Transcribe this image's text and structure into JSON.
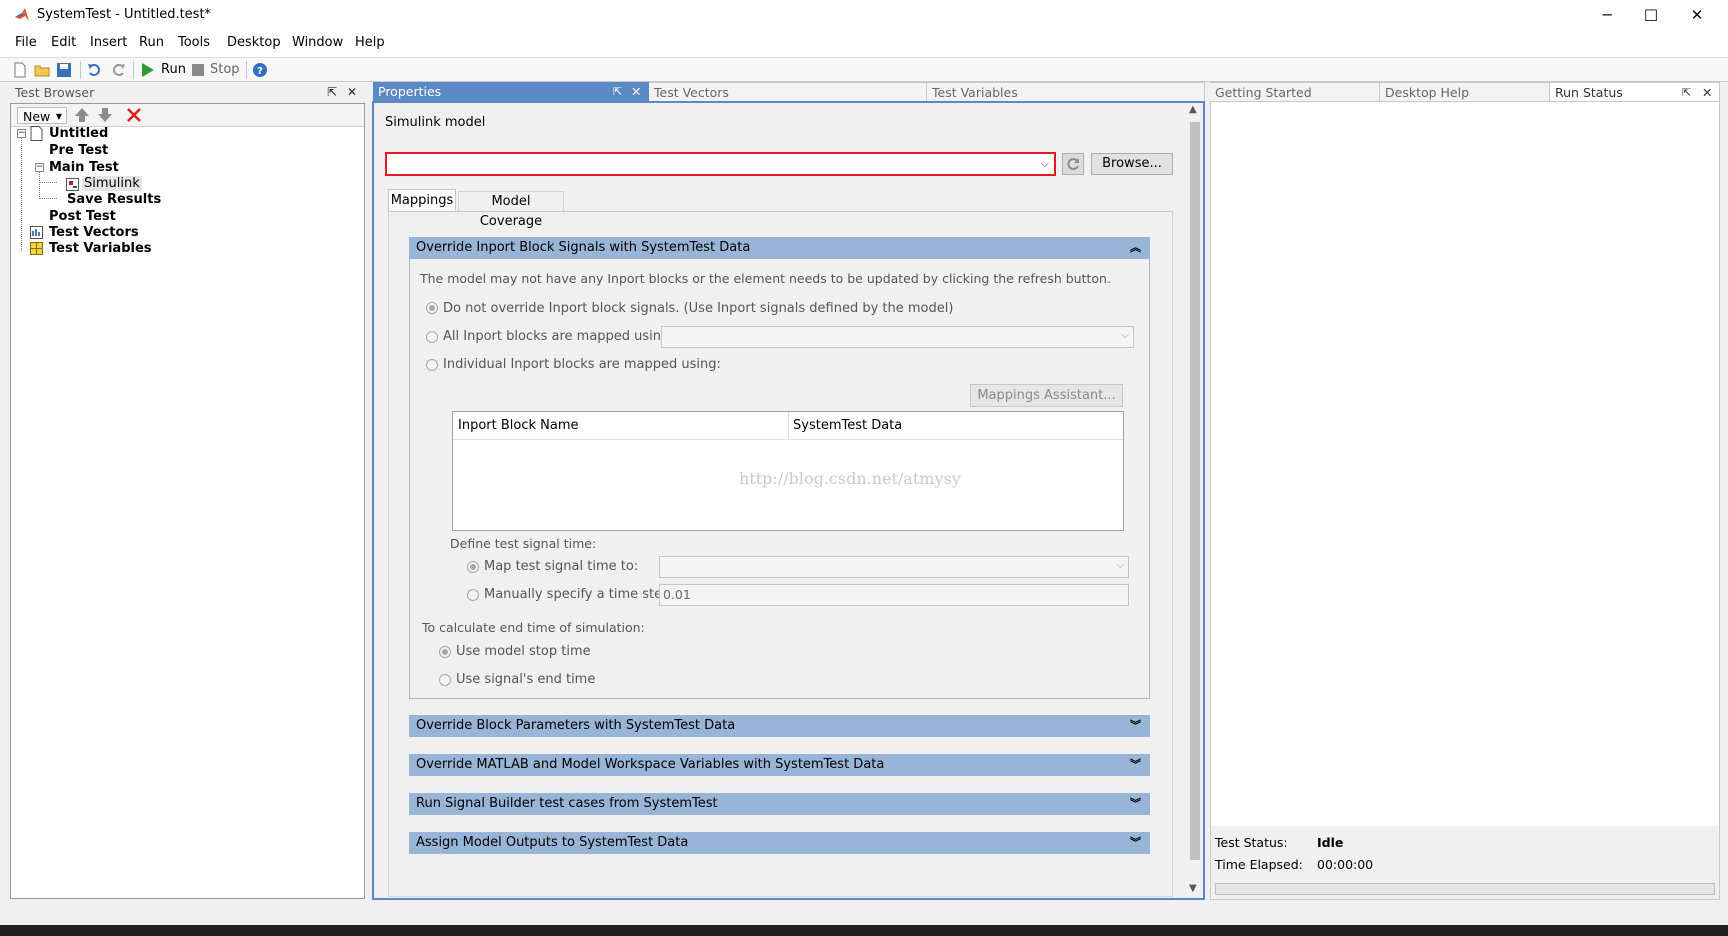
{
  "window": {
    "title": "SystemTest - Untitled.test*",
    "minimize": "─",
    "maximize": "☐",
    "close": "✕"
  },
  "menu": [
    "File",
    "Edit",
    "Insert",
    "Run",
    "Tools",
    "Desktop",
    "Window",
    "Help"
  ],
  "toolbar": {
    "run_label": "Run",
    "stop_label": "Stop"
  },
  "test_browser": {
    "title": "Test Browser",
    "new_label": "New",
    "tree": {
      "root": "Untitled",
      "pre_test": "Pre Test",
      "main_test": "Main Test",
      "simulink": "Simulink",
      "save_results": "Save Results",
      "post_test": "Post Test",
      "test_vectors": "Test Vectors",
      "test_variables": "Test Variables"
    }
  },
  "center_tabs": {
    "properties": "Properties",
    "test_vectors": "Test Vectors",
    "test_variables": "Test Variables"
  },
  "properties": {
    "simulink_model_label": "Simulink model",
    "model_value": "",
    "browse_label": "Browse...",
    "tabs": {
      "mappings": "Mappings",
      "model_coverage": "Model Coverage"
    },
    "override_inport": {
      "header": "Override Inport Block Signals with SystemTest Data",
      "note": "The model may not have any Inport blocks or the element needs to be updated by clicking the refresh button.",
      "opt_no_override": "Do not override Inport block signals. (Use Inport signals defined by the model)",
      "opt_all": "All Inport blocks are mapped using:",
      "opt_individual": "Individual Inport blocks are mapped using:",
      "mappings_assistant": "Mappings Assistant...",
      "table_headers": [
        "Inport Block Name",
        "SystemTest Data"
      ],
      "watermark": "http://blog.csdn.net/atmysy",
      "define_time": "Define test signal time:",
      "opt_map_time": "Map test signal time to:",
      "opt_manual_step": "Manually specify a time step:",
      "time_step_value": "0.01",
      "end_time_label": "To calculate end time of simulation:",
      "opt_model_stop": "Use model stop time",
      "opt_signal_end": "Use signal's end time"
    },
    "sections": [
      "Override Block Parameters with SystemTest Data",
      "Override MATLAB and Model Workspace Variables with SystemTest Data",
      "Run Signal Builder test cases from SystemTest",
      "Assign Model Outputs to SystemTest Data"
    ]
  },
  "right_tabs": {
    "getting_started": "Getting Started",
    "desktop_help": "Desktop Help",
    "run_status": "Run Status"
  },
  "run_status": {
    "test_status_label": "Test Status:",
    "test_status_value": "Idle",
    "time_elapsed_label": "Time Elapsed:",
    "time_elapsed_value": "00:00:00"
  },
  "colors": {
    "section_header": "#98b4d7",
    "active_tab": "#5b89c6",
    "error_border": "#e01b24"
  }
}
